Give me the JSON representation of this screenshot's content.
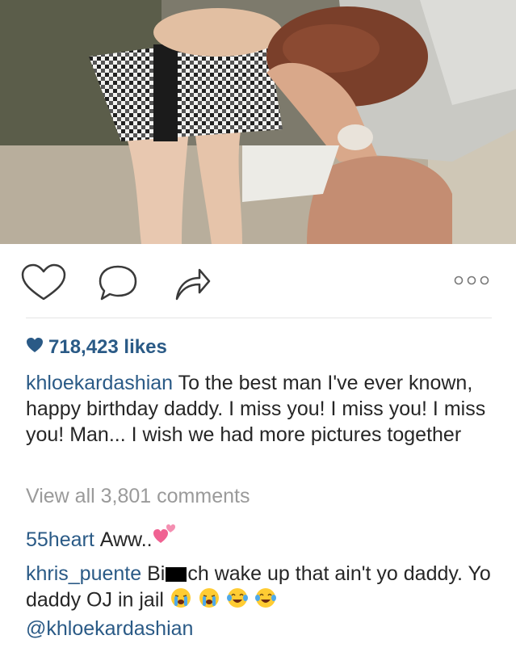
{
  "post": {
    "photo_icon": "photo-of-adult-holding-football-and-child",
    "likes_text": "718,423 likes",
    "caption": {
      "username": "khloekardashian",
      "text": "To the best man I've ever known, happy birthday daddy. I miss you! I miss you! I miss you! Man... I wish we had more pictures together"
    },
    "view_all_comments": "View all 3,801 comments",
    "comments": [
      {
        "username": "55heart",
        "text": "Aww..",
        "emoji": "two-hearts-emoji"
      },
      {
        "username": "khris_puente",
        "text_part1": "Bi",
        "text_part2": "ch wake up that ain't yo daddy. Yo daddy OJ in jail",
        "emojis": [
          "loudly-crying-emoji",
          "loudly-crying-emoji",
          "tears-of-joy-emoji",
          "tears-of-joy-emoji"
        ],
        "mention": "@khloekardashian"
      }
    ]
  },
  "colors": {
    "link": "#2a5a86",
    "text": "#262626",
    "muted": "#9a9a9a"
  }
}
